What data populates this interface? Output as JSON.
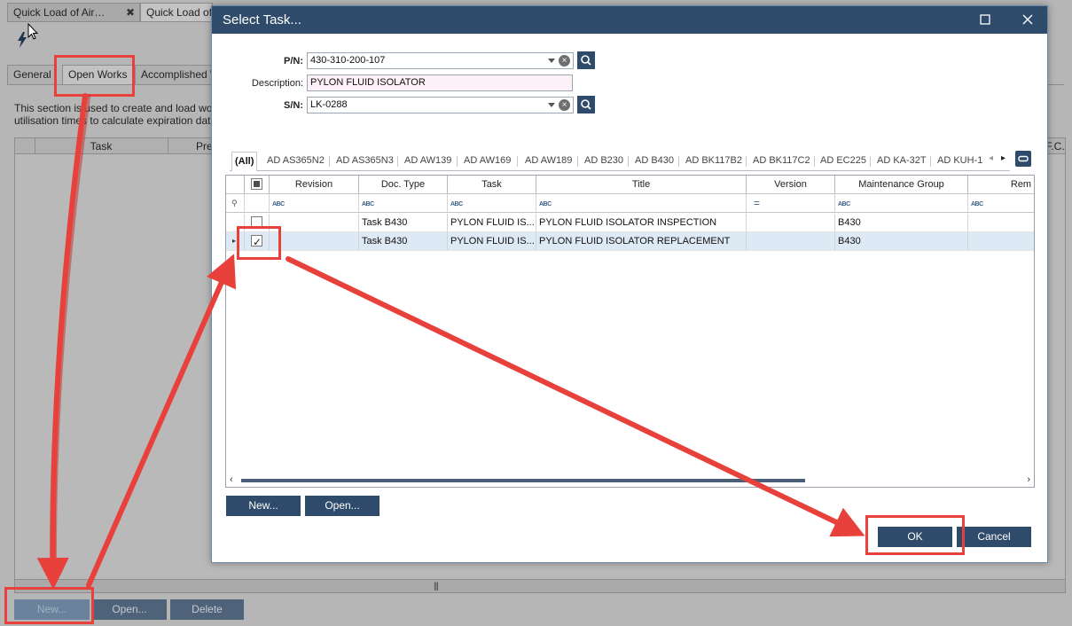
{
  "background": {
    "doc_tabs": [
      "Quick Load of Air…",
      "Quick Load of A"
    ],
    "inner_tabs": [
      "General",
      "Open Works",
      "Accomplished  W"
    ],
    "description": [
      "This section is used to create and load works in",
      "utilisation times to calculate expiration date/tir"
    ],
    "columns": [
      "Task",
      "Pref",
      "F.C."
    ],
    "buttons": [
      "New...",
      "Open...",
      "Delete"
    ]
  },
  "dialog": {
    "title": "Select Task...",
    "pn_label": "P/N:",
    "pn_value": "430-310-200-107",
    "desc_label": "Description:",
    "desc_value": "PYLON FLUID ISOLATOR",
    "sn_label": "S/N:",
    "sn_value": "LK-0288",
    "filter_tabs": [
      "(All)",
      "AD AS365N2",
      "AD AS365N3",
      "AD AW139",
      "AD AW169",
      "AD AW189",
      "AD B230",
      "AD B430",
      "AD BK117B2",
      "AD BK117C2",
      "AD EC225",
      "AD KA-32T",
      "AD KUH-1"
    ],
    "grid": {
      "columns": [
        "Revision",
        "Doc. Type",
        "Task",
        "Title",
        "Version",
        "Maintenance Group",
        "Rem"
      ],
      "rows": [
        {
          "checked": false,
          "revision": "",
          "doc_type": "Task  B430",
          "task": "PYLON FLUID IS...",
          "title": "PYLON FLUID ISOLATOR INSPECTION",
          "version": "",
          "maint_group": "B430"
        },
        {
          "checked": true,
          "revision": "",
          "doc_type": "Task  B430",
          "task": "PYLON FLUID IS...",
          "title": "PYLON FLUID ISOLATOR REPLACEMENT",
          "version": "",
          "maint_group": "B430"
        }
      ]
    },
    "buttons": {
      "new": "New...",
      "open": "Open...",
      "ok": "OK",
      "cancel": "Cancel"
    }
  },
  "colors": {
    "accent": "#2f4b6b",
    "annotation": "#e8403b",
    "selected_row": "#dde9f5"
  },
  "icons": [
    "lightning-icon",
    "maximize-icon",
    "close-icon",
    "search-icon",
    "clear-icon",
    "pin-icon",
    "link-icon"
  ]
}
